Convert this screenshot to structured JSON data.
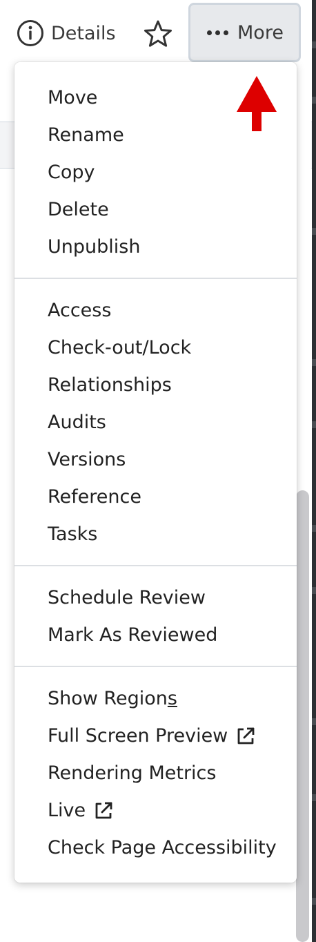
{
  "toolbar": {
    "details_label": "Details",
    "more_label": "More"
  },
  "menu": {
    "group1": [
      "Move",
      "Rename",
      "Copy",
      "Delete",
      "Unpublish"
    ],
    "group2": [
      "Access",
      "Check-out/Lock",
      "Relationships",
      "Audits",
      "Versions",
      "Reference",
      "Tasks"
    ],
    "group3": [
      "Schedule Review",
      "Mark As Reviewed"
    ],
    "group4": {
      "show_regions_main": "Show Region",
      "show_regions_underlined": "s",
      "full_screen_preview": "Full Screen Preview",
      "rendering_metrics": "Rendering Metrics",
      "live": "Live",
      "check_accessibility": "Check Page Accessibility"
    }
  },
  "icons": {
    "details": "info-circle-icon",
    "favorite": "star-outline-icon",
    "more": "ellipsis-horizontal-icon",
    "external": "external-link-icon",
    "annotation": "red-arrow-icon"
  },
  "colors": {
    "more_button_bg": "#e7e9ec",
    "more_button_border": "#cfd6de",
    "annotation_arrow": "#dd0000",
    "text": "#222222",
    "separator": "#dcdfe3"
  }
}
